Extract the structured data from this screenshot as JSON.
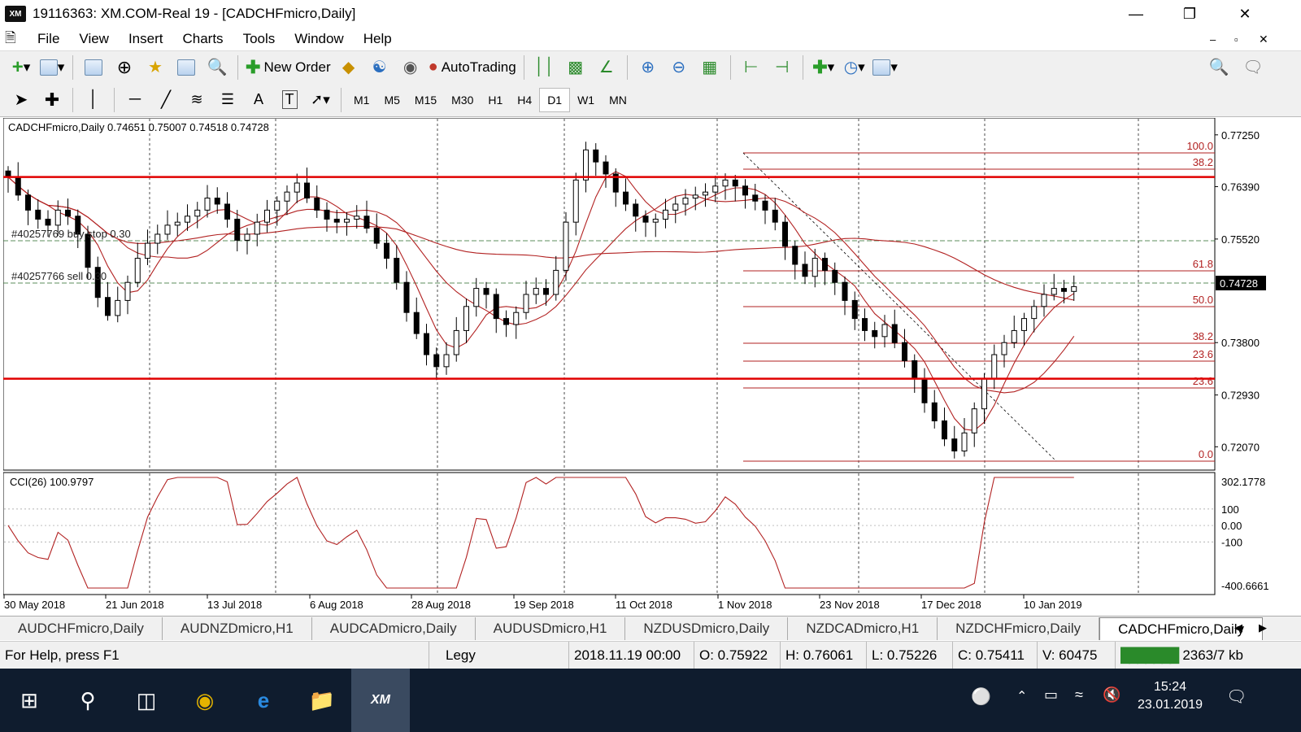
{
  "window": {
    "title": "19116363: XM.COM-Real 19 - [CADCHFmicro,Daily]",
    "logo": "XM"
  },
  "menu": [
    "File",
    "View",
    "Insert",
    "Charts",
    "Tools",
    "Window",
    "Help"
  ],
  "toolbar": {
    "new_order": "New Order",
    "autotrading": "AutoTrading"
  },
  "timeframes": [
    "M1",
    "M5",
    "M15",
    "M30",
    "H1",
    "H4",
    "D1",
    "W1",
    "MN"
  ],
  "active_timeframe": "D1",
  "chart": {
    "header": "CADCHFmicro,Daily  0.74651 0.75007 0.74518 0.74728",
    "price_axis": [
      "0.77250",
      "0.76390",
      "0.75520",
      "0.74728",
      "0.73800",
      "0.72930",
      "0.72070"
    ],
    "current_price": "0.74728",
    "date_axis": [
      "30 May 2018",
      "21 Jun 2018",
      "13 Jul 2018",
      "6 Aug 2018",
      "28 Aug 2018",
      "19 Sep 2018",
      "11 Oct 2018",
      "1 Nov 2018",
      "23 Nov 2018",
      "17 Dec 2018",
      "10 Jan 2019"
    ],
    "order_labels": [
      "#40257769 buy stop 0.30",
      "#40257766 sell 0.30"
    ],
    "fib_levels": [
      "100.0",
      "38.2",
      "61.8",
      "50.0",
      "38.2",
      "23.6",
      "23.6",
      "0.0"
    ],
    "cci_label": "CCI(26) 100.9797",
    "cci_axis": [
      "302.1778",
      "100",
      "0.00",
      "-100",
      "-400.6661"
    ]
  },
  "chart_data": {
    "type": "candlestick",
    "title": "CADCHFmicro,Daily",
    "x_range": [
      "30 May 2018",
      "23 Jan 2019"
    ],
    "ylim": [
      0.7175,
      0.7745
    ],
    "closes": [
      0.7655,
      0.7625,
      0.76,
      0.7585,
      0.7575,
      0.76,
      0.759,
      0.756,
      0.7505,
      0.7455,
      0.7425,
      0.745,
      0.748,
      0.752,
      0.7545,
      0.756,
      0.7575,
      0.758,
      0.759,
      0.76,
      0.762,
      0.761,
      0.7585,
      0.755,
      0.756,
      0.758,
      0.76,
      0.7615,
      0.763,
      0.7645,
      0.762,
      0.76,
      0.7585,
      0.758,
      0.7585,
      0.759,
      0.757,
      0.7545,
      0.752,
      0.748,
      0.743,
      0.7395,
      0.736,
      0.734,
      0.736,
      0.74,
      0.744,
      0.747,
      0.746,
      0.742,
      0.741,
      0.743,
      0.746,
      0.747,
      0.746,
      0.75,
      0.758,
      0.765,
      0.77,
      0.768,
      0.766,
      0.763,
      0.761,
      0.759,
      0.758,
      0.7585,
      0.76,
      0.761,
      0.762,
      0.7625,
      0.763,
      0.764,
      0.765,
      0.764,
      0.7625,
      0.7615,
      0.76,
      0.758,
      0.754,
      0.751,
      0.749,
      0.752,
      0.75,
      0.748,
      0.745,
      0.742,
      0.74,
      0.739,
      0.741,
      0.738,
      0.735,
      0.732,
      0.728,
      0.725,
      0.722,
      0.72,
      0.723,
      0.727,
      0.732,
      0.736,
      0.738,
      0.74,
      0.742,
      0.744,
      0.746,
      0.747,
      0.7465,
      0.7473
    ],
    "moving_averages": 3,
    "horizontal_levels": [
      0.7655,
      0.732
    ],
    "fibonacci": {
      "levels": [
        "100.0",
        "61.8",
        "50.0",
        "38.2",
        "23.6",
        "0.0"
      ]
    },
    "indicator": {
      "name": "CCI(26)",
      "value": 100.9797,
      "ylim": [
        -400.6661,
        302.1778
      ]
    }
  },
  "tabs": [
    "AUDCHFmicro,Daily",
    "AUDNZDmicro,H1",
    "AUDCADmicro,Daily",
    "AUDUSDmicro,H1",
    "NZDUSDmicro,Daily",
    "NZDCADmicro,H1",
    "NZDCHFmicro,Daily",
    "CADCHFmicro,Daily"
  ],
  "active_tab": "CADCHFmicro,Daily",
  "status": {
    "help": "For Help, press F1",
    "profile": "Legy",
    "time": "2018.11.19 00:00",
    "open": "O: 0.75922",
    "high": "H: 0.76061",
    "low": "L: 0.75226",
    "close": "C: 0.75411",
    "volume": "V: 60475",
    "traffic": "2363/7 kb"
  },
  "taskbar": {
    "time": "15:24",
    "date": "23.01.2019",
    "app": "XM"
  },
  "colors": {
    "candle": "#000000",
    "level": "#e00000",
    "ma": "#b22222",
    "fib": "#b22222"
  }
}
